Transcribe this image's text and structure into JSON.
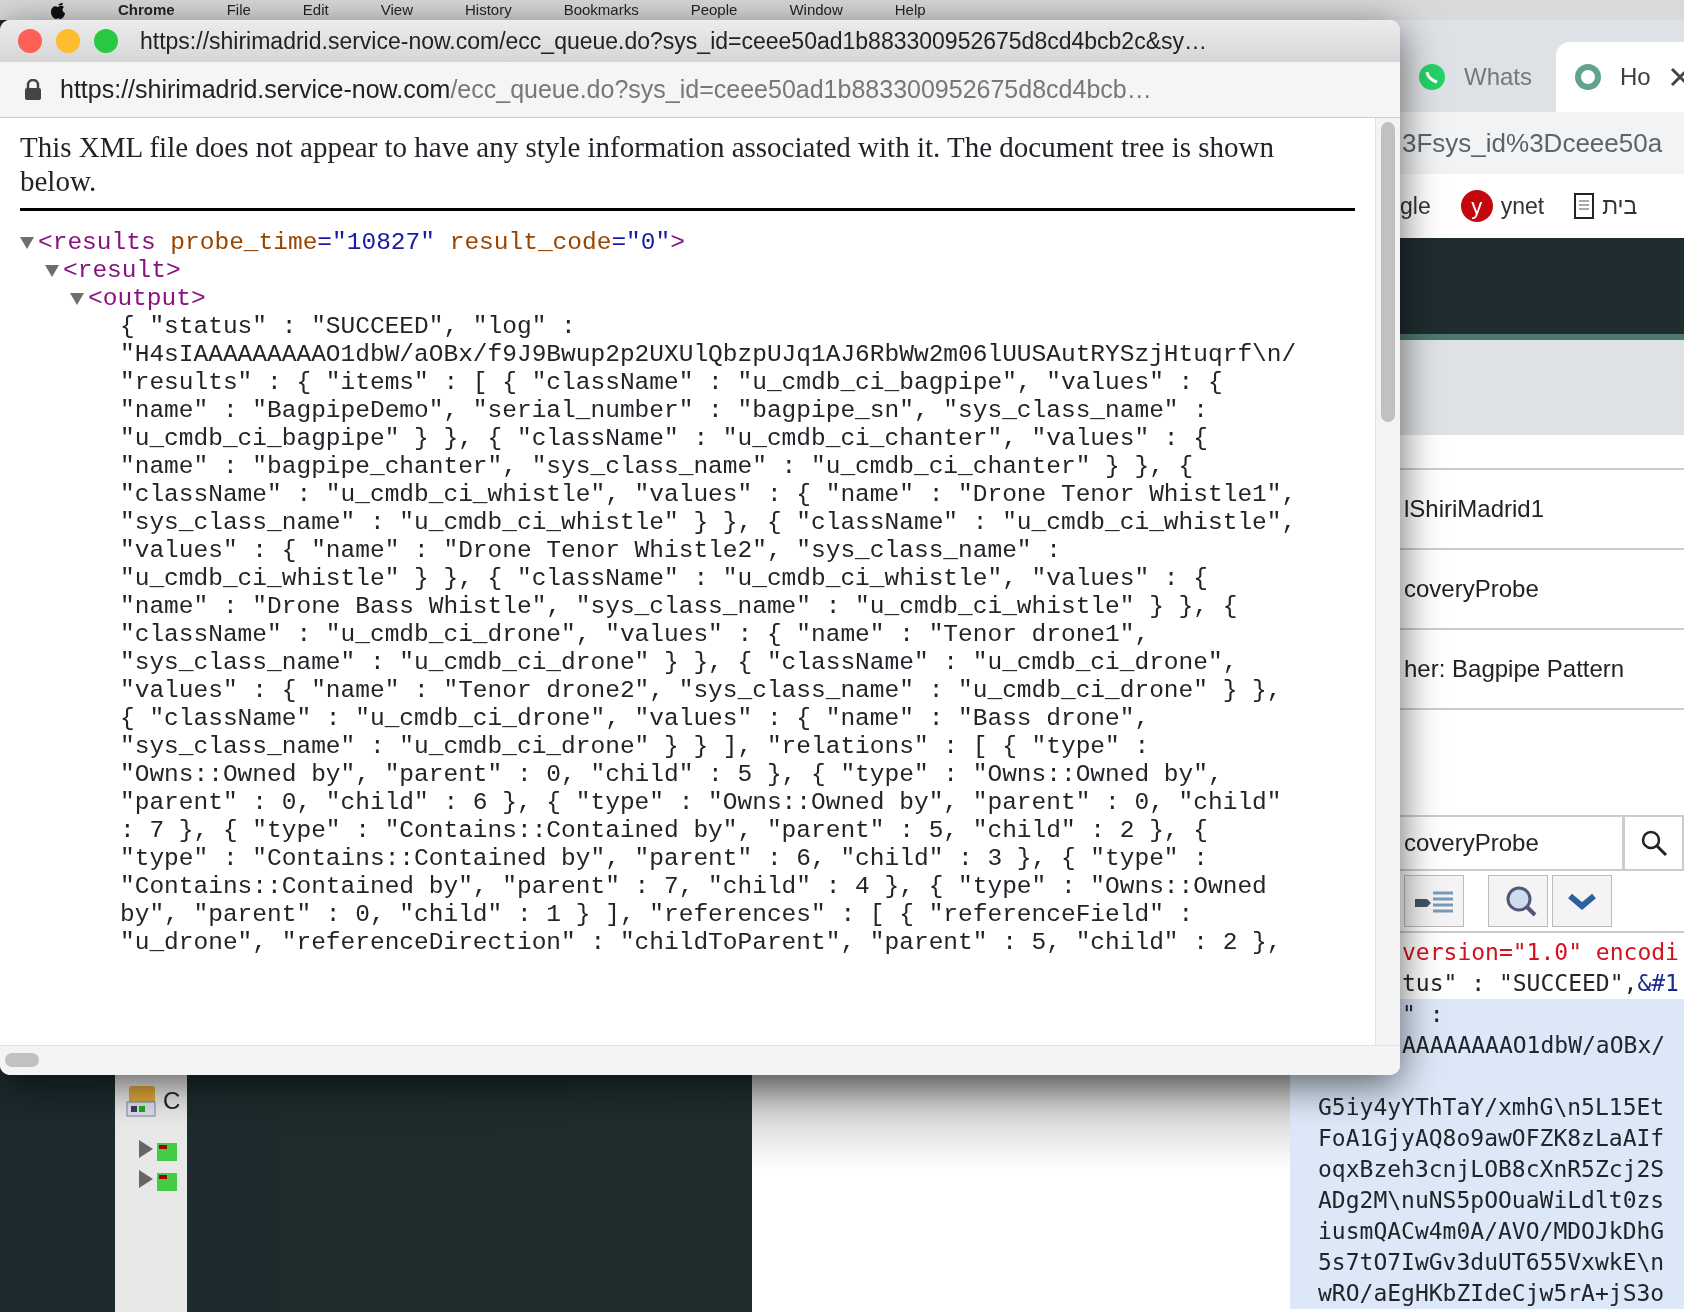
{
  "menu_bar": {
    "app": "Chrome",
    "items": [
      "File",
      "Edit",
      "View",
      "History",
      "Bookmarks",
      "People",
      "Window",
      "Help"
    ]
  },
  "popup_window": {
    "title": "https://shirimadrid.service-now.com/ecc_queue.do?sys_id=ceee50ad1b883300952675d8cd4bcb2c&sy…",
    "address": {
      "host": "https://shirimadrid.service-now.com",
      "path": "/ecc_queue.do?sys_id=ceee50ad1b883300952675d8cd4bcb…"
    },
    "notice": "This XML file does not appear to have any style information associated with it. The document tree is shown below.",
    "xml_tree": [
      {
        "tag": "<results",
        "attributes": [
          {
            "name": "probe_time",
            "value": "=\"10827\""
          },
          {
            "name": "result_code",
            "value": "=\"0\""
          }
        ],
        "close": ">",
        "expanded": true,
        "children": [
          {
            "tag": "<result",
            "close": ">",
            "expanded": true,
            "children": [
              {
                "tag": "<output",
                "close": ">",
                "expanded": true,
                "text_lines": [
                  "{ \"status\" : \"SUCCEED\", \"log\" :",
                  "\"H4sIAAAAAAAAAO1dbW/aOBx/f9J9Bwup2p2UXUlQbzpUJq1AJ6RbWw2m06lUUSAutRYSzjHtuqrf\\n/",
                  "\"results\" : { \"items\" : [ { \"className\" : \"u_cmdb_ci_bagpipe\", \"values\" : {",
                  "\"name\" : \"BagpipeDemo\", \"serial_number\" : \"bagpipe_sn\", \"sys_class_name\" :",
                  "\"u_cmdb_ci_bagpipe\" } }, { \"className\" : \"u_cmdb_ci_chanter\", \"values\" : {",
                  "\"name\" : \"bagpipe_chanter\", \"sys_class_name\" : \"u_cmdb_ci_chanter\" } }, {",
                  "\"className\" : \"u_cmdb_ci_whistle\", \"values\" : { \"name\" : \"Drone Tenor Whistle1\",",
                  "\"sys_class_name\" : \"u_cmdb_ci_whistle\" } }, { \"className\" : \"u_cmdb_ci_whistle\",",
                  "\"values\" : { \"name\" : \"Drone Tenor Whistle2\", \"sys_class_name\" :",
                  "\"u_cmdb_ci_whistle\" } }, { \"className\" : \"u_cmdb_ci_whistle\", \"values\" : {",
                  "\"name\" : \"Drone Bass Whistle\", \"sys_class_name\" : \"u_cmdb_ci_whistle\" } }, {",
                  "\"className\" : \"u_cmdb_ci_drone\", \"values\" : { \"name\" : \"Tenor drone1\",",
                  "\"sys_class_name\" : \"u_cmdb_ci_drone\" } }, { \"className\" : \"u_cmdb_ci_drone\",",
                  "\"values\" : { \"name\" : \"Tenor drone2\", \"sys_class_name\" : \"u_cmdb_ci_drone\" } },",
                  "{ \"className\" : \"u_cmdb_ci_drone\", \"values\" : { \"name\" : \"Bass drone\",",
                  "\"sys_class_name\" : \"u_cmdb_ci_drone\" } } ], \"relations\" : [ { \"type\" :",
                  "\"Owns::Owned by\", \"parent\" : 0, \"child\" : 5 }, { \"type\" : \"Owns::Owned by\",",
                  "\"parent\" : 0, \"child\" : 6 }, { \"type\" : \"Owns::Owned by\", \"parent\" : 0, \"child\"",
                  ": 7 }, { \"type\" : \"Contains::Contained by\", \"parent\" : 5, \"child\" : 2 }, {",
                  "\"type\" : \"Contains::Contained by\", \"parent\" : 6, \"child\" : 3 }, { \"type\" :",
                  "\"Contains::Contained by\", \"parent\" : 7, \"child\" : 4 }, { \"type\" : \"Owns::Owned",
                  "by\", \"parent\" : 0, \"child\" : 1 } ], \"references\" : [ { \"referenceField\" :",
                  "\"u_drone\", \"referenceDirection\" : \"childToParent\", \"parent\" : 5, \"child\" : 2 },"
                ]
              }
            ]
          }
        ]
      }
    ]
  },
  "back_window": {
    "tabs": [
      {
        "label": "Whats",
        "kind": "chat",
        "selected": false
      },
      {
        "label": "Ho",
        "kind": "ring",
        "selected": true
      }
    ],
    "address": "3Fsys_id%3Dceee50a",
    "bookmarks": [
      {
        "label": "gle",
        "kind": "plain"
      },
      {
        "label": "ynet",
        "kind": "letter",
        "letter": "y"
      },
      {
        "label": "בית",
        "kind": "page"
      }
    ],
    "fields": [
      "lShiriMadrid1",
      "coveryProbe",
      "her: Bagpipe Pattern"
    ],
    "search_field": "coveryProbe",
    "code_head": [
      [
        {
          "text": "version=\"1.0\" encodi",
          "kind": "declaration"
        }
      ],
      [
        {
          "text": "tus\" : \"SUCCEED\",",
          "kind": "plain"
        },
        {
          "text": "&#1",
          "kind": "entity"
        }
      ],
      [
        {
          "text": "\" :",
          "kind": "plain"
        }
      ],
      [
        {
          "text": "AAAAAAAAO1dbW/aOBx/",
          "kind": "plain"
        }
      ]
    ],
    "code_lines": [
      "G5iy4yYThTaY/xmhG\\n5L15Et",
      "FoA1GjyAQ8o9awOFZK8zLaAIf",
      "oqxBzeh3cnjLOB8cXnR5Zcj2S",
      "ADg2M\\nuNS5pOOuaWiLdlt0zs",
      "iusmQACw4m0A/AVO/MDOJkDhG",
      "5s7tO7IwGv3duUT655VxwkE\\n",
      "wRO/aEgHKbZIdeCjw5rA+jS3o"
    ]
  },
  "ide_panel": {
    "header": "C"
  }
}
